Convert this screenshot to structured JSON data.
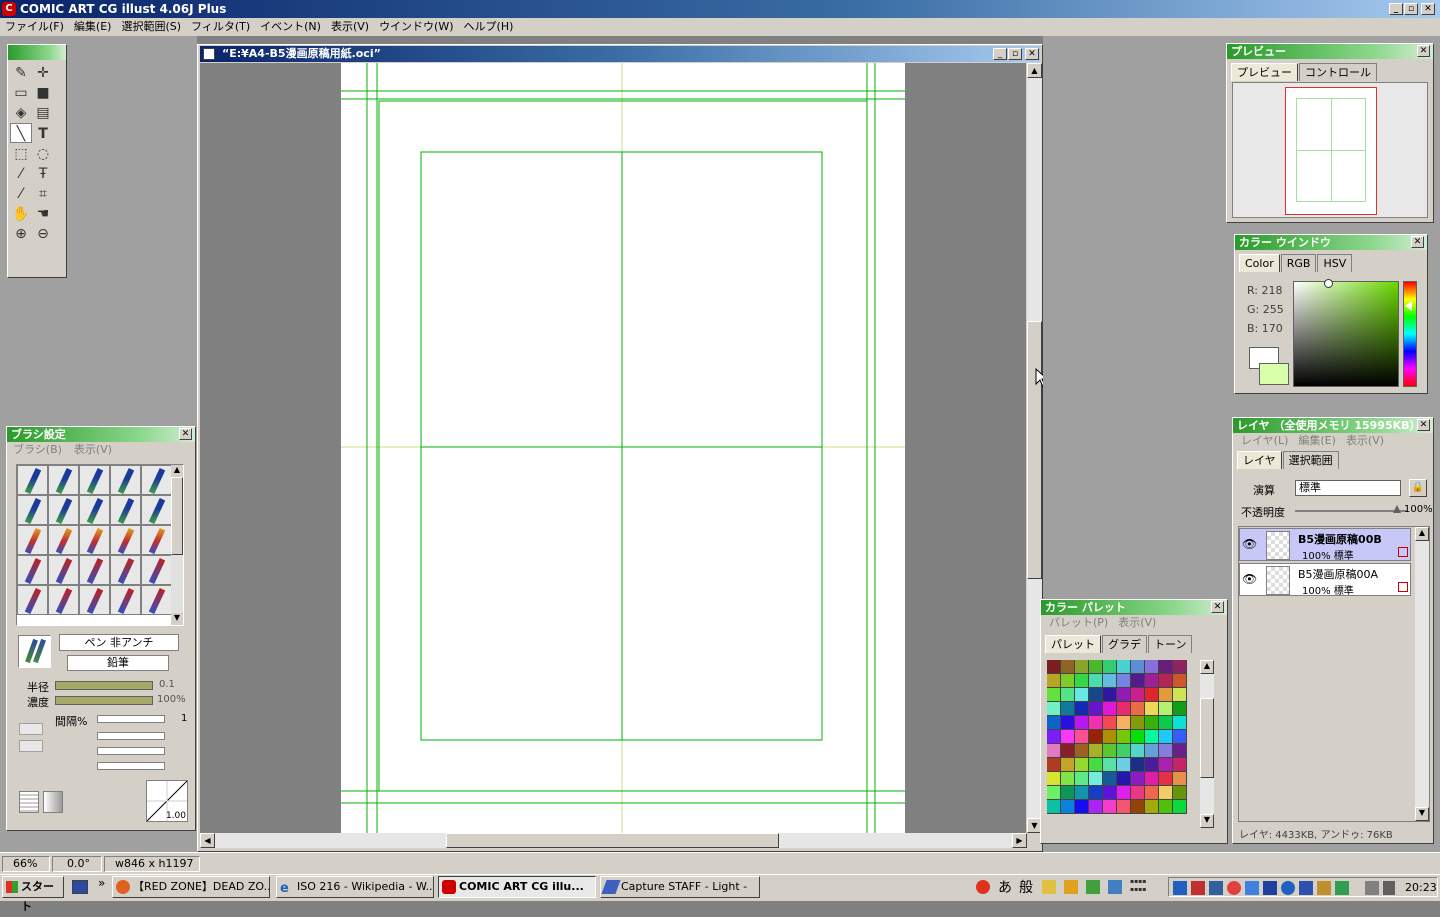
{
  "app": {
    "title": "COMIC ART CG illust 4.06J Plus"
  },
  "menu": [
    "ファイル(F)",
    "編集(E)",
    "選択範囲(S)",
    "フィルタ(T)",
    "イベント(N)",
    "表示(V)",
    "ウインドウ(W)",
    "ヘルプ(H)"
  ],
  "document": {
    "title": "“E:¥A4-B5漫画原稿用紙.oci”"
  },
  "preview": {
    "title": "プレビュー",
    "tabs": [
      "プレビュー",
      "コントロール"
    ]
  },
  "color_window": {
    "title": "カラー ウインドウ",
    "tabs": [
      "Color",
      "RGB",
      "HSV"
    ],
    "r": "R: 218",
    "g": "G: 255",
    "b": "B: 170",
    "fg": "#ffffff",
    "bg": "#daffaa"
  },
  "layers": {
    "title": "レイヤ （全使用メモリ 15995KB）",
    "menu": [
      "レイヤ(L)",
      "編集(E)",
      "表示(V)"
    ],
    "tabs": [
      "レイヤ",
      "選択範囲"
    ],
    "blend_label": "演算",
    "blend_value": "標準",
    "opacity_label": "不透明度",
    "opacity_value": "100%",
    "items": [
      {
        "name": "B5漫画原稿00B",
        "info": "100%  標準",
        "selected": true
      },
      {
        "name": "B5漫画原稿00A",
        "info": "100%  標準",
        "selected": false
      }
    ],
    "status": "レイヤ: 4433KB, アンドゥ: 76KB"
  },
  "palette": {
    "title": "カラー パレット",
    "menu": [
      "パレット(P)",
      "表示(V)"
    ],
    "tabs": [
      "パレット",
      "グラデ",
      "トーン"
    ]
  },
  "brush": {
    "title": "ブラシ設定",
    "menu": [
      "ブラシ(B)",
      "表示(V)"
    ],
    "name1": "ペン 非アンチ",
    "name2": "鉛筆",
    "radius_label": "半径",
    "radius_value": "0.1",
    "density_label": "濃度",
    "density_value": "100%",
    "interval_label": "間隔%",
    "interval_value": "1",
    "curve_value": "1.00"
  },
  "status_bar": {
    "zoom": "66%",
    "angle": "0.0°",
    "size": "w846 x h1197"
  },
  "taskbar": {
    "start": "スタート",
    "buttons": [
      "【RED ZONE】DEAD ZO...",
      "ISO 216 - Wikipedia - W...",
      "COMIC ART CG illu...",
      "Capture STAFF - Light -"
    ],
    "ime": [
      "あ",
      "般"
    ],
    "clock": "20:23"
  },
  "colors": {
    "guide": "#00b000",
    "accent_green": "#2a9a2a",
    "title_blue": "#0a246a"
  }
}
